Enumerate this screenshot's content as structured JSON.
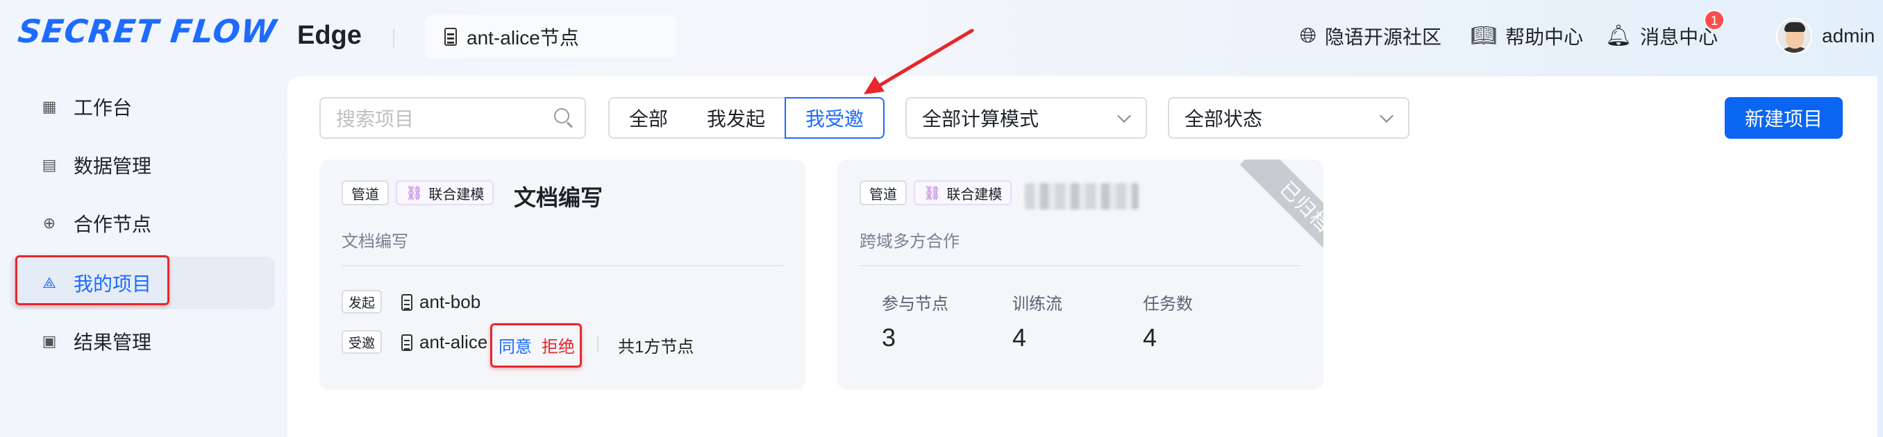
{
  "header": {
    "logo": "SECRET FLOW",
    "env_title": "Edge",
    "node_selector": "ant-alice节点",
    "community": "隐语开源社区",
    "help": "帮助中心",
    "messages": "消息中心",
    "message_count": "1",
    "user": "admin"
  },
  "sidebar": {
    "items": [
      {
        "label": "工作台",
        "icon": "grid-icon"
      },
      {
        "label": "数据管理",
        "icon": "table-icon"
      },
      {
        "label": "合作节点",
        "icon": "globe-icon"
      },
      {
        "label": "我的项目",
        "icon": "project-icon",
        "active": true
      },
      {
        "label": "结果管理",
        "icon": "result-icon"
      }
    ]
  },
  "toolbar": {
    "search_placeholder": "搜索项目",
    "filters": [
      "全部",
      "我发起",
      "我受邀"
    ],
    "selected_filter": "我受邀",
    "compute_mode": "全部计算模式",
    "status": "全部状态",
    "new_project": "新建项目"
  },
  "cards": [
    {
      "tag_pipeline": "管道",
      "tag_mode": "联合建模",
      "title": "文档编写",
      "description": "文档编写",
      "initiator_label": "发起",
      "initiator": "ant-bob",
      "invitee_label": "受邀",
      "invitee": "ant-alice",
      "accept": "同意",
      "reject": "拒绝",
      "node_count": "共1方节点"
    },
    {
      "tag_pipeline": "管道",
      "tag_mode": "联合建模",
      "description": "跨域多方合作",
      "ribbon": "已归档",
      "stats": [
        {
          "label": "参与节点",
          "value": "3"
        },
        {
          "label": "训练流",
          "value": "4"
        },
        {
          "label": "任务数",
          "value": "4"
        }
      ]
    }
  ],
  "colors": {
    "accent": "#1e6bff",
    "primary_button": "#0a66f2",
    "annotation_red": "#e8262b"
  }
}
